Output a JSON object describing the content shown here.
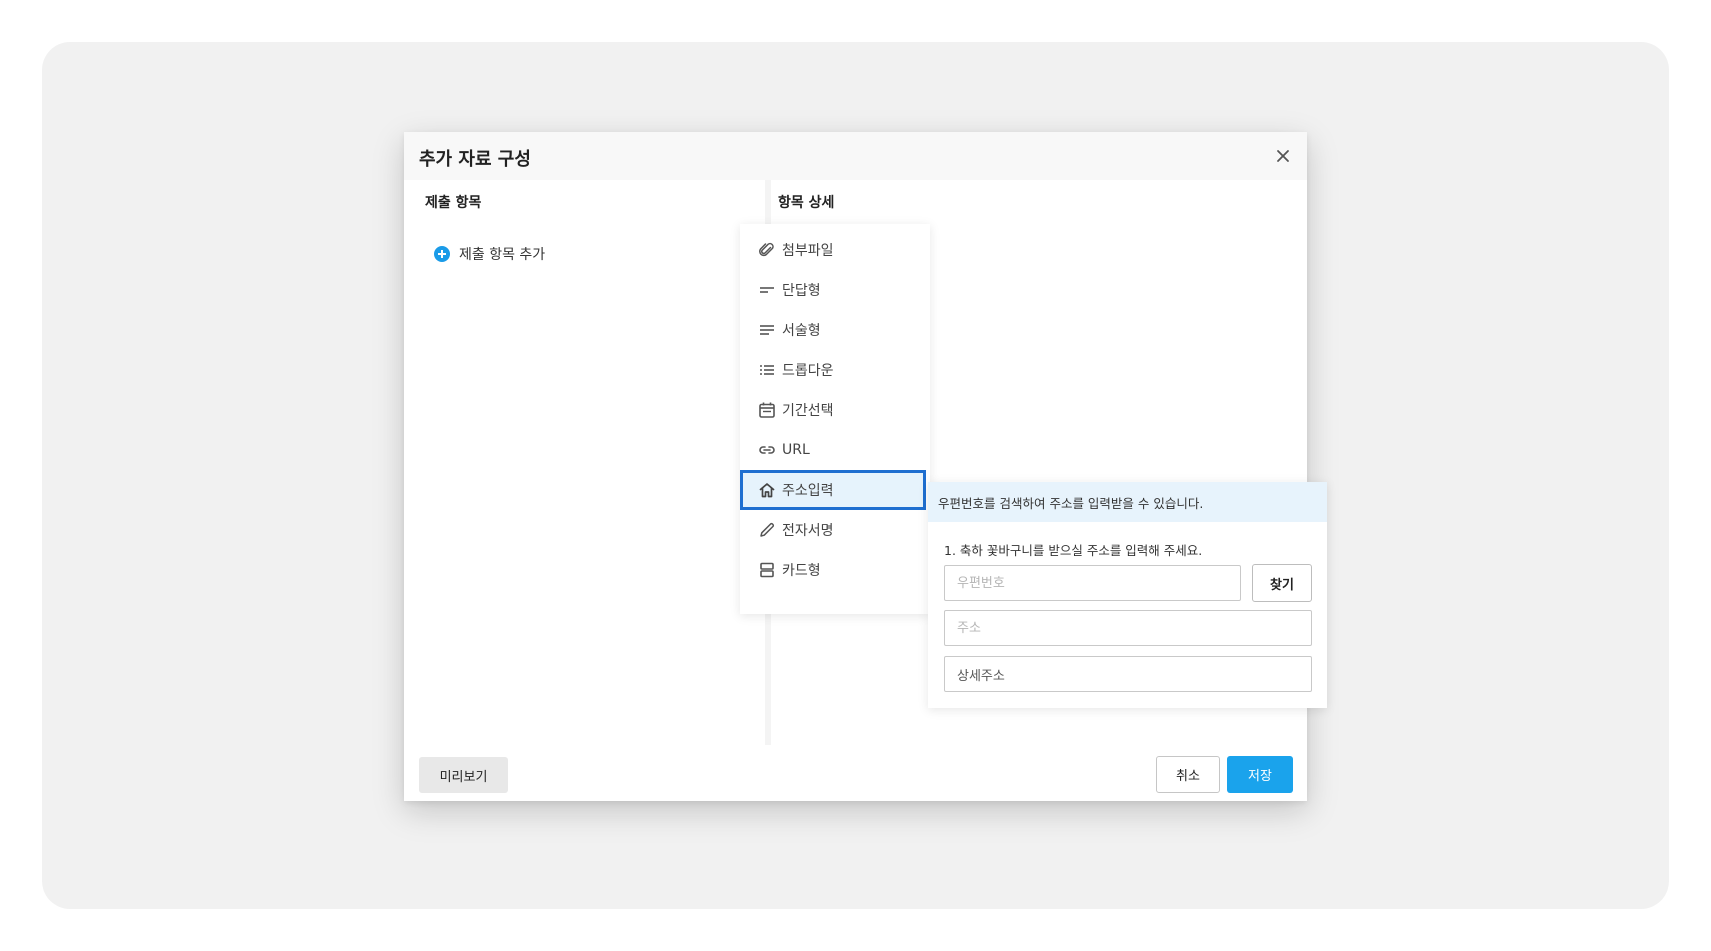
{
  "modal": {
    "title": "추가 자료 구성",
    "close_icon": "close-icon"
  },
  "left": {
    "heading": "제출 항목",
    "add_label": "제출 항목 추가",
    "add_icon": "plus-circle-icon"
  },
  "right": {
    "heading": "항목 상세"
  },
  "types": [
    {
      "label": "첨부파일",
      "icon": "paperclip-icon"
    },
    {
      "label": "단답형",
      "icon": "short-text-icon"
    },
    {
      "label": "서술형",
      "icon": "long-text-icon"
    },
    {
      "label": "드롭다운",
      "icon": "list-icon"
    },
    {
      "label": "기간선택",
      "icon": "calendar-icon"
    },
    {
      "label": "URL",
      "icon": "link-icon"
    },
    {
      "label": "주소입력",
      "icon": "home-icon",
      "selected": true
    },
    {
      "label": "전자서명",
      "icon": "pencil-icon"
    },
    {
      "label": "카드형",
      "icon": "card-icon"
    }
  ],
  "detail": {
    "description": "우편번호를 검색하여 주소를 입력받을 수 있습니다.",
    "question": "1.  축하 꽃바구니를 받으실 주소를 입력해 주세요.",
    "postcode_placeholder": "우편번호",
    "address_placeholder": "주소",
    "detail_address_value": "상세주소",
    "find_label": "찾기"
  },
  "footer": {
    "preview_label": "미리보기",
    "cancel_label": "취소",
    "save_label": "저장"
  },
  "colors": {
    "accent": "#1aa3ec",
    "selected_border": "#1f6fd0",
    "selected_bg": "#e6f3fc"
  }
}
